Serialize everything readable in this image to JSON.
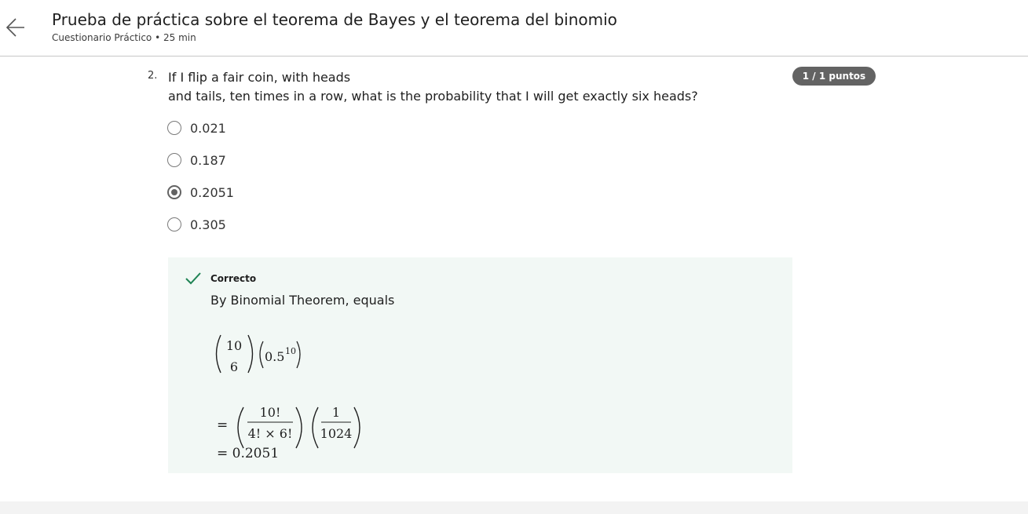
{
  "header": {
    "title": "Prueba de práctica sobre el teorema de Bayes y el teorema del binomio",
    "subtitle": "Cuestionario Práctico • 25 min"
  },
  "question": {
    "number": "2.",
    "text_line1": "If I flip a fair coin, with heads",
    "text_line2": "and tails, ten times in a row, what is the probability that I will get exactly six heads?",
    "points": "1 / 1 puntos",
    "options": [
      {
        "label": "0.021",
        "selected": false
      },
      {
        "label": "0.187",
        "selected": false
      },
      {
        "label": "0.2051",
        "selected": true
      },
      {
        "label": "0.305",
        "selected": false
      }
    ]
  },
  "feedback": {
    "status": "Correcto",
    "text": "By Binomial Theorem, equals",
    "formula": {
      "binom_top": "10",
      "binom_bottom": "6",
      "power_base": "0.5",
      "power_exp": "10",
      "equals": "=",
      "frac1_num": "10!",
      "frac1_den": "4! × 6!",
      "frac2_num": "1",
      "frac2_den": "1024",
      "result": "= 0.2051"
    },
    "color": "#1f8354"
  }
}
